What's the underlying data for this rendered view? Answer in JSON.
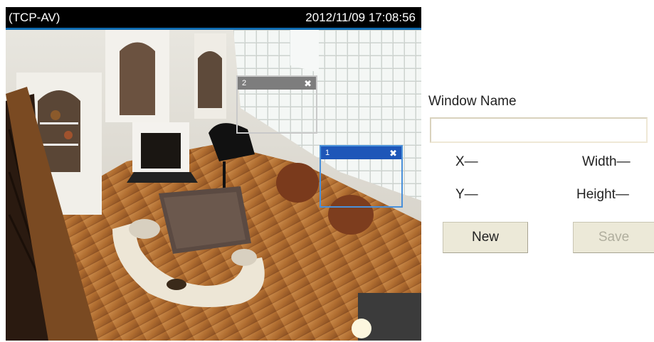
{
  "camera": {
    "label": "(TCP-AV)",
    "datetime": "2012/11/09  17:08:56",
    "motion_windows": [
      {
        "label": "2",
        "close_icon": "close-icon",
        "state": "inactive"
      },
      {
        "label": "1",
        "close_icon": "close-icon",
        "state": "active"
      }
    ]
  },
  "settings": {
    "window_name_label": "Window Name",
    "window_name_value": "",
    "x_label": "X—",
    "y_label": "Y—",
    "width_label": "Width—",
    "height_label": "Height—",
    "new_button": "New",
    "save_button": "Save",
    "save_enabled": false
  },
  "colors": {
    "header_bg": "#000000",
    "active_window": "#1e56b8",
    "inactive_window": "#7d7d7d",
    "button_bg": "#ece9d8"
  }
}
